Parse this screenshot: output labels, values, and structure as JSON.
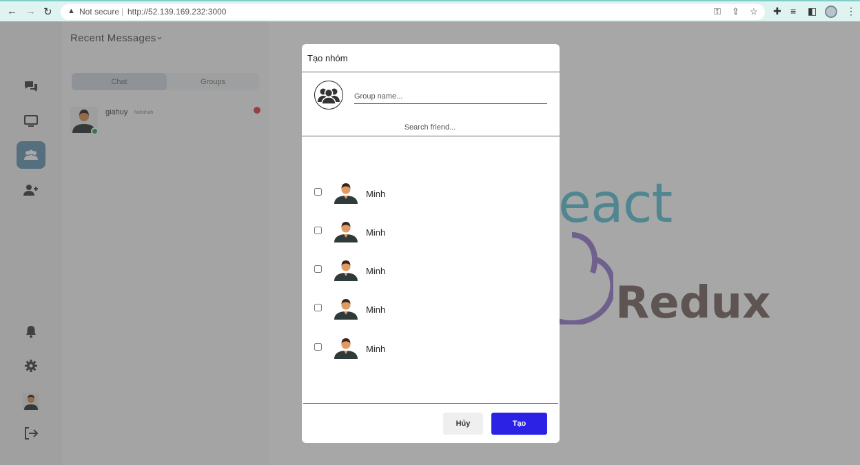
{
  "browser": {
    "security_text": "Not secure",
    "url": "http://52.139.169.232:3000"
  },
  "panel": {
    "title": "Recent Messages",
    "tabs": [
      {
        "label": "Chat",
        "active": true
      },
      {
        "label": "Groups",
        "active": false
      }
    ],
    "conversations": [
      {
        "name": "giahuy",
        "subtitle": "hahahah",
        "online": true,
        "unread": true
      }
    ]
  },
  "background_brand": {
    "line1": "eact",
    "line2": "Redux"
  },
  "modal": {
    "title": "Tạo nhóm",
    "group_name_placeholder": "Group name...",
    "search_placeholder": "Search friend...",
    "friends": [
      {
        "name": "Minh",
        "checked": false
      },
      {
        "name": "Minh",
        "checked": false
      },
      {
        "name": "Minh",
        "checked": false
      },
      {
        "name": "Minh",
        "checked": false
      },
      {
        "name": "Minh",
        "checked": false
      }
    ],
    "cancel_label": "Hủy",
    "create_label": "Tạo"
  },
  "colors": {
    "accent": "#2b22e6",
    "sidebar_active": "#6a9ab5",
    "online": "#3aa455",
    "unread": "#e0444a"
  }
}
